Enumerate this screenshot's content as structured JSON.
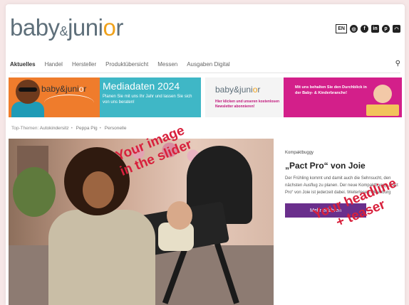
{
  "header": {
    "logo_text_a": "baby",
    "logo_text_amp": "&",
    "logo_text_b": "juni",
    "logo_text_o": "o",
    "logo_text_c": "r",
    "lang": "EN",
    "social_icons": [
      "instagram-icon",
      "facebook-icon",
      "linkedin-icon",
      "pinterest-icon",
      "rss-icon"
    ]
  },
  "nav": {
    "items": [
      "Aktuelles",
      "Handel",
      "Hersteller",
      "Produktübersicht",
      "Messen",
      "Ausgaben Digital"
    ],
    "active": "Aktuelles",
    "search_icon": "search-icon"
  },
  "banner_left": {
    "logo_a": "baby",
    "logo_amp": "&",
    "logo_b": "juni",
    "logo_o": "o",
    "logo_c": "r",
    "title": "Mediadaten 2024",
    "subtitle": "Planen Sie mit uns Ihr Jahr und lassen Sie sich von uns beraten!"
  },
  "banner_right": {
    "logo_a": "baby",
    "logo_amp": "&",
    "logo_b": "juni",
    "logo_o": "o",
    "logo_c": "r",
    "sub": "Hier klicken und unseren kostenlosen Newsletter abonnieren!",
    "text": "Mit uns behalten Sie den Durchblick in der Baby- & Kinderbranche!"
  },
  "top_themes": {
    "label": "Top-Themen:",
    "items": [
      "Autokindersitz",
      "Peppa Pig",
      "Personelle"
    ]
  },
  "hero": {
    "overlay_line1": "Your image",
    "overlay_line2": "in the slider"
  },
  "article": {
    "kicker": "Kompaktbuggy",
    "headline": "„Pact Pro“ von Joie",
    "teaser": "Der Frühling kommt und damit auch die Sehnsucht, den nächsten Ausflug zu planen. Der neue Kompaktbuggy „Pact Pro“ von Joie ist jederzeit dabei. Weiterlesen Oldenburg",
    "button": "Mehr erfahren",
    "overlay_line1": "Your headline",
    "overlay_line2": "+ teaser"
  },
  "colors": {
    "logo_gray": "#5e6f7a",
    "logo_orange": "#f0a21c",
    "banner_orange": "#ef7c2c",
    "banner_teal": "#3fb7c6",
    "banner_magenta": "#d31f8a",
    "button_purple": "#6a2f8c",
    "overlay_red": "#d8203c"
  }
}
